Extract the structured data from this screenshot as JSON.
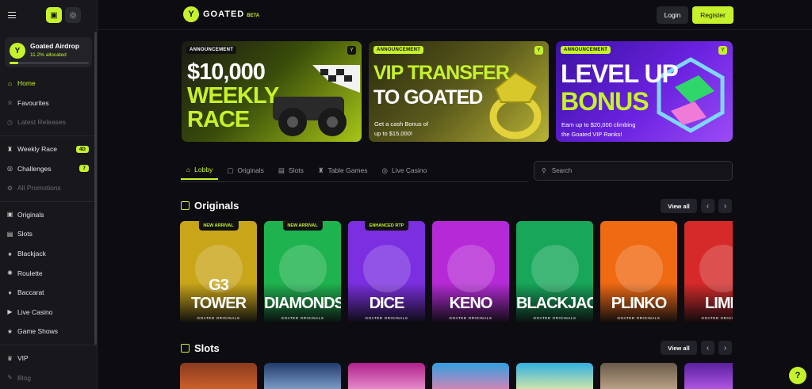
{
  "sidebar": {
    "airdrop": {
      "title": "Goated Airdrop",
      "allocated": "11.2% allocated",
      "progress": 0.112
    },
    "items": [
      {
        "label": "Home",
        "icon": "home-icon",
        "active": true
      },
      {
        "label": "Favourites",
        "icon": "star-icon"
      },
      {
        "label": "Latest Releases",
        "icon": "clock-icon",
        "dim": true
      },
      {
        "label": "Weekly Race",
        "icon": "trophy-icon",
        "badge": "4D"
      },
      {
        "label": "Challenges",
        "icon": "target-icon",
        "badge": "7"
      },
      {
        "label": "All Promotions",
        "icon": "gift-icon",
        "dim": true
      },
      {
        "label": "Originals",
        "icon": "originals-icon"
      },
      {
        "label": "Slots",
        "icon": "slots-icon"
      },
      {
        "label": "Blackjack",
        "icon": "spade-icon"
      },
      {
        "label": "Roulette",
        "icon": "roulette-icon"
      },
      {
        "label": "Baccarat",
        "icon": "cards-icon"
      },
      {
        "label": "Live Casino",
        "icon": "live-icon"
      },
      {
        "label": "Game Shows",
        "icon": "show-icon"
      },
      {
        "label": "VIP",
        "icon": "crown-icon"
      },
      {
        "label": "Blog",
        "icon": "blog-icon",
        "dim": true
      }
    ]
  },
  "header": {
    "brand": "GOATED",
    "beta": "BETA",
    "login": "Login",
    "register": "Register"
  },
  "banners": [
    {
      "tag": "ANNOUNCEMENT",
      "line1": "$10,000",
      "line2": "WEEKLY",
      "line3": "RACE"
    },
    {
      "tag": "ANNOUNCEMENT",
      "line1": "VIP TRANSFER",
      "line2": "TO GOATED",
      "sub1": "Get a cash Bonus of",
      "sub2": "up to $15,000!"
    },
    {
      "tag": "ANNOUNCEMENT",
      "line1": "LEVEL UP",
      "line2": "BONUS",
      "sub1": "Earn up to $20,000 climbing",
      "sub2": "the Goated VIP Ranks!"
    }
  ],
  "tabs": [
    "Lobby",
    "Originals",
    "Slots",
    "Table Games",
    "Live Casino"
  ],
  "search": {
    "placeholder": "Search"
  },
  "originals": {
    "title": "Originals",
    "view_all": "View all",
    "subtitle": "GOATED ORIGINALS",
    "games": [
      {
        "name": "G3 TOWER",
        "tag": "NEW ARRIVAL",
        "color": "#c9a51a"
      },
      {
        "name": "DIAMONDS",
        "tag": "NEW ARRIVAL",
        "color": "#1fb34f"
      },
      {
        "name": "DICE",
        "tag": "ENHANCED RTP",
        "color": "#7b2fe0"
      },
      {
        "name": "KENO",
        "tag": "",
        "color": "#b52ad6"
      },
      {
        "name": "BLACKJACK",
        "tag": "",
        "color": "#17a65a"
      },
      {
        "name": "PLINKO",
        "tag": "",
        "color": "#f06a14"
      },
      {
        "name": "LIMB",
        "tag": "",
        "color": "#d62a2a"
      }
    ]
  },
  "slots": {
    "title": "Slots",
    "view_all": "View all"
  },
  "colors": {
    "accent": "#c6f22c",
    "bg": "#0d0d11",
    "sidebar": "#17171c"
  }
}
